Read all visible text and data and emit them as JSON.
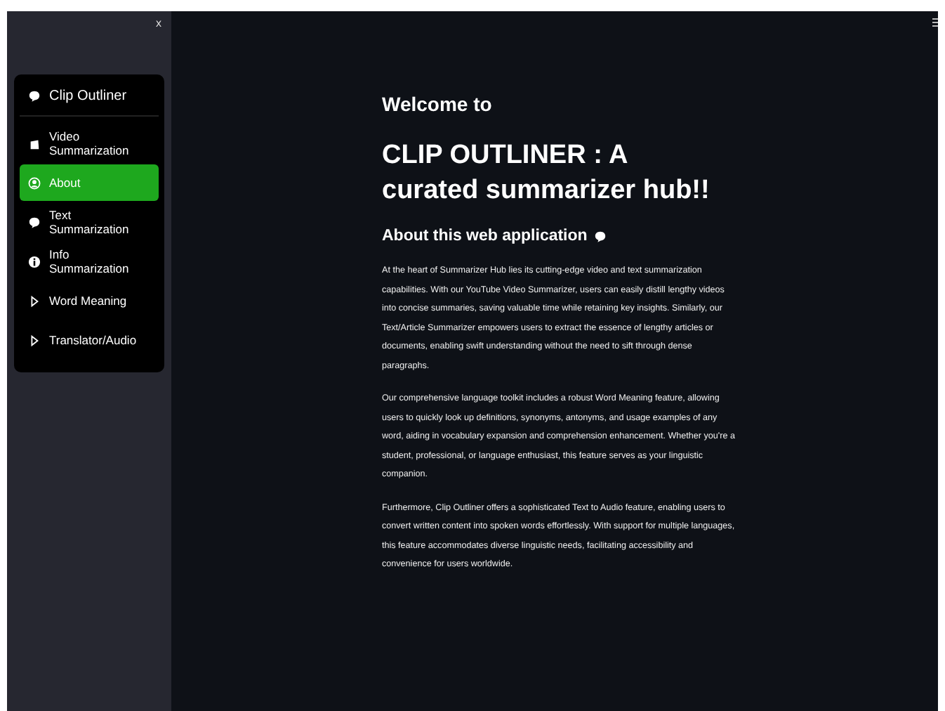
{
  "sidebar": {
    "close": "x",
    "menu": {
      "title": "Clip Outliner",
      "items": [
        {
          "label": "Video Summarization",
          "selected": false
        },
        {
          "label": "About",
          "selected": true
        },
        {
          "label": "Text Summarization",
          "selected": false
        },
        {
          "label": "Info Summarization",
          "selected": false
        },
        {
          "label": "Word Meaning",
          "selected": false
        },
        {
          "label": "Translator/Audio",
          "selected": false
        }
      ]
    }
  },
  "main": {
    "welcome": "Welcome to",
    "title": "CLIP OUTLINER : A curated summarizer hub!!",
    "subtitle": "About this web application",
    "paragraphs": [
      "At the heart of Summarizer Hub lies its cutting-edge video and text summarization capabilities. With our YouTube Video Summarizer, users can easily distill lengthy videos into concise summaries, saving valuable time while retaining key insights. Similarly, our Text/Article Summarizer empowers users to extract the essence of lengthy articles or documents, enabling swift understanding without the need to sift through dense paragraphs.",
      "Our comprehensive language toolkit includes a robust Word Meaning feature, allowing users to quickly look up definitions, synonyms, antonyms, and usage examples of any word, aiding in vocabulary expansion and comprehension enhancement. Whether you're a student, professional, or language enthusiast, this feature serves as your linguistic companion.",
      "Furthermore, Clip Outliner offers a sophisticated Text to Audio feature, enabling users to convert written content into spoken words effortlessly. With support for multiple languages, this feature accommodates diverse linguistic needs, facilitating accessibility and convenience for users worldwide."
    ]
  }
}
